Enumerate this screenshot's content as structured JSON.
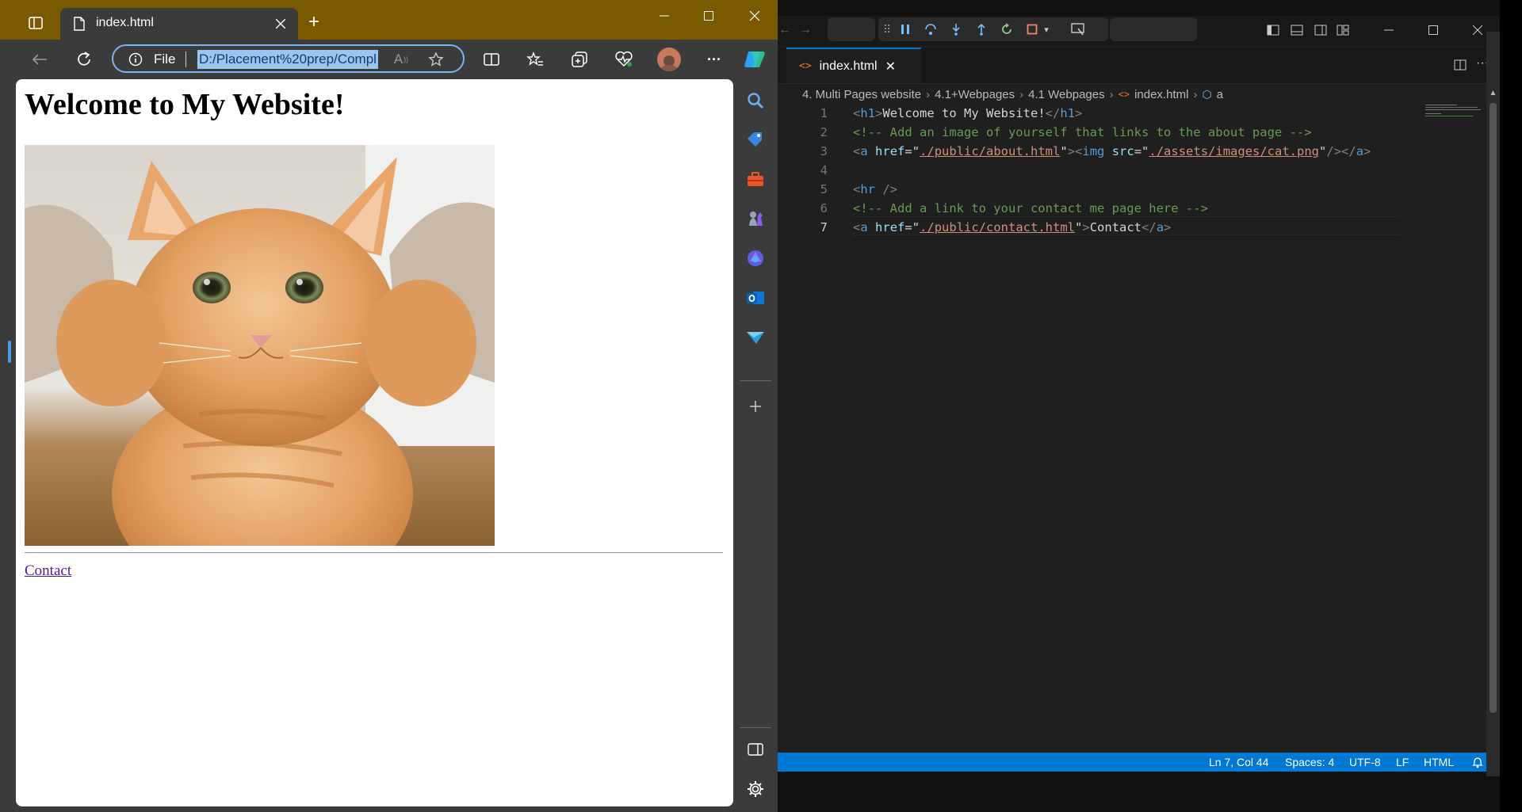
{
  "browser": {
    "tab_title": "index.html",
    "new_tab_symbol": "+",
    "address_scheme": "File",
    "address_url": "D:/Placement%20prep/Compl",
    "reader_symbol": "A",
    "page": {
      "heading": "Welcome to My Website!",
      "link_text": "Contact"
    }
  },
  "editor": {
    "tab_title": "index.html",
    "breadcrumb": [
      "4. Multi Pages website",
      "4.1+Webpages",
      "4.1 Webpages",
      "index.html",
      "a"
    ],
    "code_lines": [
      {
        "n": "1",
        "parts": [
          {
            "c": "pn",
            "t": "<"
          },
          {
            "c": "tag",
            "t": "h1"
          },
          {
            "c": "pn",
            "t": ">"
          },
          {
            "c": "tx",
            "t": "Welcome to My Website!"
          },
          {
            "c": "pn",
            "t": "</"
          },
          {
            "c": "tag",
            "t": "h1"
          },
          {
            "c": "pn",
            "t": ">"
          }
        ]
      },
      {
        "n": "2",
        "parts": [
          {
            "c": "cm",
            "t": "<!-- Add an image of yourself that links to the about page -->"
          }
        ]
      },
      {
        "n": "3",
        "parts": [
          {
            "c": "pn",
            "t": "<"
          },
          {
            "c": "tag",
            "t": "a"
          },
          {
            "c": "tx",
            "t": " "
          },
          {
            "c": "attr",
            "t": "href"
          },
          {
            "c": "tx",
            "t": "=\""
          },
          {
            "c": "str",
            "t": "./public/about.html"
          },
          {
            "c": "tx",
            "t": "\""
          },
          {
            "c": "pn",
            "t": "><"
          },
          {
            "c": "tag",
            "t": "img"
          },
          {
            "c": "tx",
            "t": " "
          },
          {
            "c": "attr",
            "t": "src"
          },
          {
            "c": "tx",
            "t": "=\""
          },
          {
            "c": "str",
            "t": "./assets/images/cat.png"
          },
          {
            "c": "tx",
            "t": "\""
          },
          {
            "c": "pn",
            "t": "/></"
          },
          {
            "c": "tag",
            "t": "a"
          },
          {
            "c": "pn",
            "t": ">"
          }
        ]
      },
      {
        "n": "4",
        "parts": []
      },
      {
        "n": "5",
        "parts": [
          {
            "c": "pn",
            "t": "<"
          },
          {
            "c": "tag",
            "t": "hr"
          },
          {
            "c": "pn",
            "t": " />"
          }
        ]
      },
      {
        "n": "6",
        "parts": [
          {
            "c": "cm",
            "t": "<!-- Add a link to your contact me page here -->"
          }
        ]
      },
      {
        "n": "7",
        "parts": [
          {
            "c": "pn",
            "t": "<"
          },
          {
            "c": "tag",
            "t": "a"
          },
          {
            "c": "tx",
            "t": " "
          },
          {
            "c": "attr",
            "t": "href"
          },
          {
            "c": "tx",
            "t": "=\""
          },
          {
            "c": "str",
            "t": "./public/contact.html"
          },
          {
            "c": "tx",
            "t": "\""
          },
          {
            "c": "pn",
            "t": ">"
          },
          {
            "c": "tx",
            "t": "Contact"
          },
          {
            "c": "pn",
            "t": "</"
          },
          {
            "c": "tag",
            "t": "a"
          },
          {
            "c": "pn",
            "t": ">"
          }
        ]
      }
    ],
    "current_line": "7",
    "status": {
      "position": "Ln 7, Col 44",
      "spaces": "Spaces: 4",
      "encoding": "UTF-8",
      "eol": "LF",
      "language": "HTML"
    }
  },
  "colors": {
    "edge_titlebar": "#7a5a00",
    "vscode_status": "#0078d4",
    "link": "#551a8b"
  },
  "icons": [
    "tab-actions-icon",
    "page-icon",
    "close-icon",
    "new-tab-icon",
    "minimize-icon",
    "maximize-icon",
    "back-icon",
    "refresh-icon",
    "info-icon",
    "read-aloud-icon",
    "favorite-star-icon",
    "split-screen-icon",
    "favorites-icon",
    "collections-icon",
    "health-icon",
    "profile-avatar",
    "more-icon",
    "copilot-icon",
    "search-icon",
    "tag-icon",
    "toolbox-icon",
    "chess-icon",
    "copilot-apps-icon",
    "outlook-icon",
    "send-icon",
    "add-icon",
    "sidebar-toggle-icon",
    "settings-icon",
    "pause-icon",
    "step-over-icon",
    "step-into-icon",
    "step-out-icon",
    "restart-icon",
    "stop-icon",
    "split-editor-icon",
    "bell-icon"
  ]
}
